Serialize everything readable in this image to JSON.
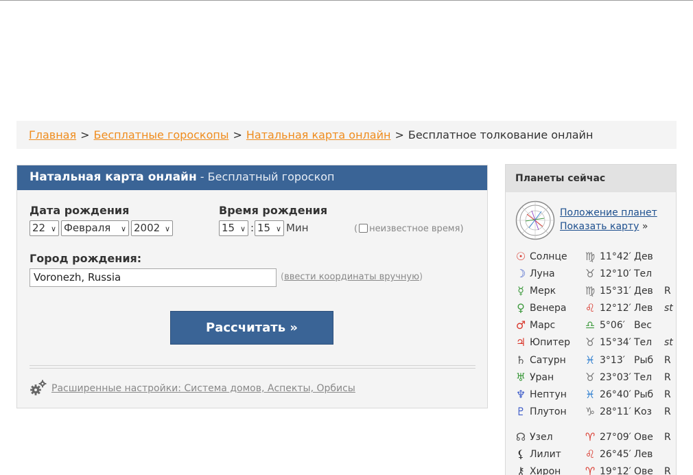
{
  "breadcrumb": {
    "items": [
      "Главная",
      "Бесплатные гороскопы",
      "Натальная карта онлайн"
    ],
    "separator": ">",
    "current": "Бесплатное толкование онлайн"
  },
  "form": {
    "title": "Натальная карта онлайн",
    "subtitle": "- Бесплатный гороскоп",
    "birth_date_label": "Дата рождения",
    "day": "22",
    "month": "Февраля",
    "year": "2002",
    "birth_time_label": "Время рождения",
    "hour": "15",
    "time_separator": ":",
    "minute": "15",
    "minute_unit": "Мин",
    "unknown_time_open": "(",
    "unknown_time_label": "неизвестное время",
    "unknown_time_close": ")",
    "city_label": "Город рождения:",
    "city_value": "Voronezh, Russia",
    "manual_open": "(",
    "manual_coords_link": "ввести координаты вручную",
    "manual_close": ")",
    "submit_label": "Рассчитать »",
    "advanced_link": "Расширенные настройки: Система домов, Аспекты, Орбисы"
  },
  "planets_now": {
    "title": "Планеты сейчас",
    "positions_link": "Положение планет",
    "show_chart_link": "Показать карту",
    "show_chart_arrow": "»",
    "rows": [
      {
        "glyph": "☉",
        "glyph_color": "#d9362b",
        "name": "Солнце",
        "sign_glyph": "♍",
        "sign_color": "#777777",
        "degree": "11°42′",
        "sign": "Дев",
        "flag": ""
      },
      {
        "glyph": "☽",
        "glyph_color": "#3a59c8",
        "name": "Луна",
        "sign_glyph": "♉",
        "sign_color": "#777777",
        "degree": "12°10′",
        "sign": "Тел",
        "flag": ""
      },
      {
        "glyph": "☿",
        "glyph_color": "#3e9a3e",
        "name": "Мерк",
        "sign_glyph": "♍",
        "sign_color": "#777777",
        "degree": "15°31′",
        "sign": "Дев",
        "flag": "R"
      },
      {
        "glyph": "♀",
        "glyph_color": "#3e9a3e",
        "name": "Венера",
        "sign_glyph": "♌",
        "sign_color": "#d9362b",
        "degree": "12°12′",
        "sign": "Лев",
        "flag": "st"
      },
      {
        "glyph": "♂",
        "glyph_color": "#d9362b",
        "name": "Марс",
        "sign_glyph": "♎",
        "sign_color": "#3e9a3e",
        "degree": "5°06′",
        "sign": "Вес",
        "flag": ""
      },
      {
        "glyph": "♃",
        "glyph_color": "#d9362b",
        "name": "Юпитер",
        "sign_glyph": "♉",
        "sign_color": "#777777",
        "degree": "15°34′",
        "sign": "Тел",
        "flag": "st"
      },
      {
        "glyph": "♄",
        "glyph_color": "#555555",
        "name": "Сатурн",
        "sign_glyph": "♓",
        "sign_color": "#2f7fd0",
        "degree": "3°13′",
        "sign": "Рыб",
        "flag": "R"
      },
      {
        "glyph": "♅",
        "glyph_color": "#3e9a3e",
        "name": "Уран",
        "sign_glyph": "♉",
        "sign_color": "#777777",
        "degree": "23°03′",
        "sign": "Тел",
        "flag": "R"
      },
      {
        "glyph": "♆",
        "glyph_color": "#3a59c8",
        "name": "Нептун",
        "sign_glyph": "♓",
        "sign_color": "#2f7fd0",
        "degree": "26°40′",
        "sign": "Рыб",
        "flag": "R"
      },
      {
        "glyph": "♇",
        "glyph_color": "#3a59c8",
        "name": "Плутон",
        "sign_glyph": "♑",
        "sign_color": "#777777",
        "degree": "28°11′",
        "sign": "Коз",
        "flag": "R"
      }
    ],
    "extra_rows": [
      {
        "glyph": "☊",
        "glyph_color": "#555555",
        "name": "Узел",
        "sign_glyph": "♈",
        "sign_color": "#d9362b",
        "degree": "27°09′",
        "sign": "Ове",
        "flag": "R"
      },
      {
        "glyph": "⚸",
        "glyph_color": "#333333",
        "name": "Лилит",
        "sign_glyph": "♌",
        "sign_color": "#d9362b",
        "degree": "26°45′",
        "sign": "Лев",
        "flag": ""
      },
      {
        "glyph": "⚷",
        "glyph_color": "#333333",
        "name": "Хирон",
        "sign_glyph": "♈",
        "sign_color": "#d9362b",
        "degree": "19°12′",
        "sign": "Ове",
        "flag": "R"
      }
    ]
  }
}
